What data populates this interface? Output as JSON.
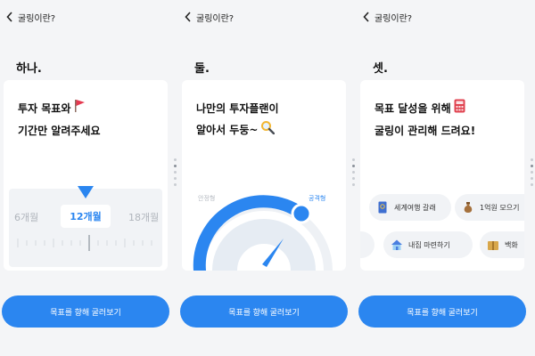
{
  "header": {
    "title": "굴링이란?"
  },
  "cta_label": "목표를 향해 굴러보기",
  "slides": [
    {
      "step": "하나.",
      "title_line1": "투자 목표와",
      "title_line2": "기간만 알려주세요",
      "picker": {
        "left": "6개월",
        "selected": "12개월",
        "right": "18개월"
      }
    },
    {
      "step": "둘.",
      "title_line1": "나만의 투자플랜이",
      "title_line2": "알아서 두둥~",
      "gauge": {
        "left_label": "안정형",
        "right_label": "공격형"
      }
    },
    {
      "step": "셋.",
      "title_line1": "목표 달성을 위해",
      "title_line2": "굴링이 관리해 드려요!",
      "chips": [
        "세계여행 갈래",
        "1억원 모으기",
        "내집 마련하기",
        "백화"
      ]
    }
  ],
  "colors": {
    "accent": "#2b86f0",
    "background": "#f4f5f7"
  }
}
